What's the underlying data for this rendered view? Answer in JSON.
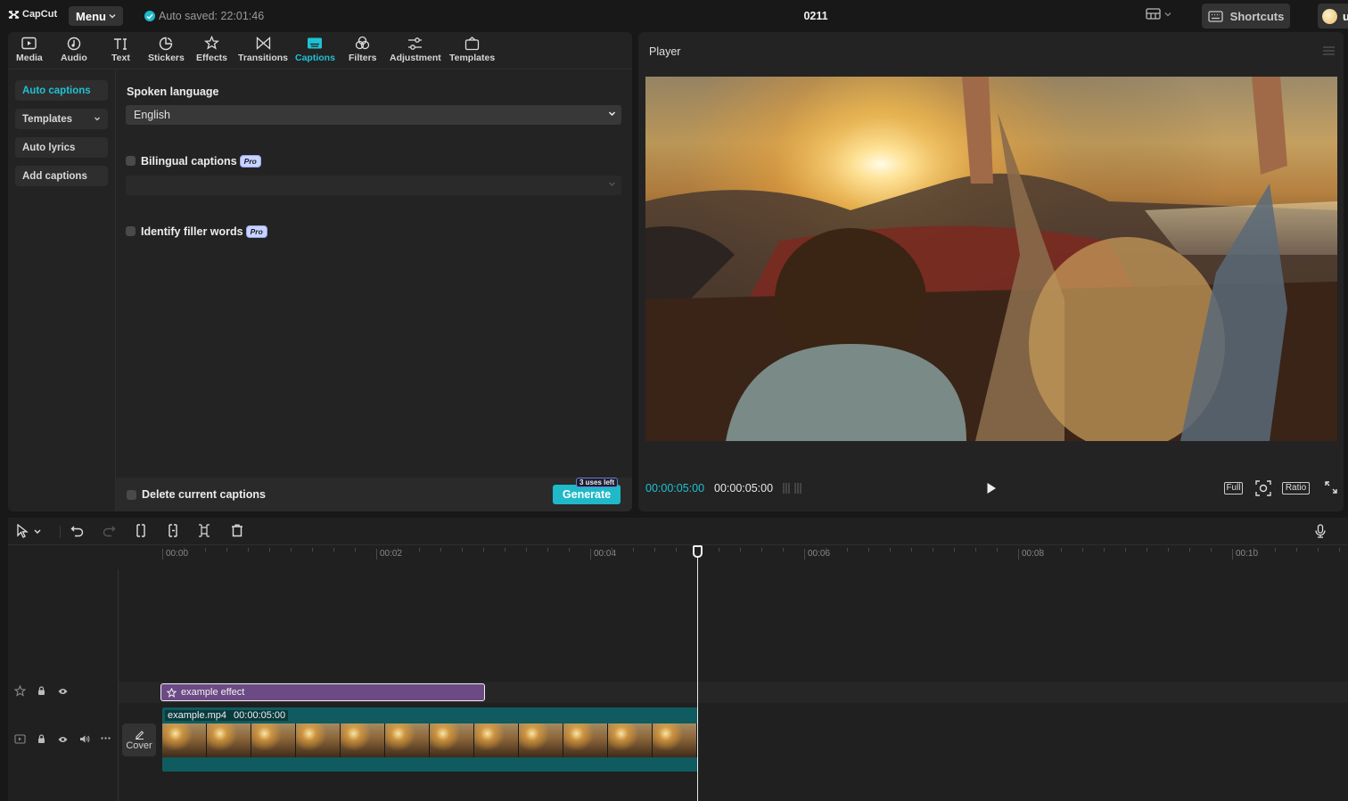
{
  "app": {
    "name": "CapCut",
    "menu_label": "Menu",
    "autosave_text": "Auto saved: 22:01:46",
    "project_title": "0211",
    "shortcuts_label": "Shortcuts",
    "user_initial": "u"
  },
  "toolbar": {
    "items": [
      {
        "label": "Media",
        "icon": "media-icon"
      },
      {
        "label": "Audio",
        "icon": "audio-icon"
      },
      {
        "label": "Text",
        "icon": "text-icon"
      },
      {
        "label": "Stickers",
        "icon": "stickers-icon"
      },
      {
        "label": "Effects",
        "icon": "effects-icon"
      },
      {
        "label": "Transitions",
        "icon": "transitions-icon"
      },
      {
        "label": "Captions",
        "icon": "captions-icon",
        "active": true
      },
      {
        "label": "Filters",
        "icon": "filters-icon"
      },
      {
        "label": "Adjustment",
        "icon": "adjustment-icon"
      },
      {
        "label": "Templates",
        "icon": "templates-icon"
      }
    ]
  },
  "sidenav": {
    "items": [
      {
        "label": "Auto captions",
        "active": true
      },
      {
        "label": "Templates",
        "has_dropdown": true
      },
      {
        "label": "Auto lyrics"
      },
      {
        "label": "Add captions"
      }
    ]
  },
  "captions": {
    "spoken_language_label": "Spoken language",
    "spoken_language_value": "English",
    "bilingual_label": "Bilingual captions",
    "bilingual_checked": false,
    "bilingual_value": "",
    "filler_label": "Identify filler words",
    "filler_checked": false,
    "pro_badge": "Pro",
    "delete_label": "Delete current captions",
    "delete_checked": false,
    "generate_label": "Generate",
    "uses_left": "3 uses left"
  },
  "player": {
    "title": "Player",
    "current_time": "00:00:05:00",
    "total_time": "00:00:05:00",
    "full_label": "Full",
    "ratio_label": "Ratio"
  },
  "timeline": {
    "ruler_labels": [
      "00:00",
      "00:02",
      "00:04",
      "00:06",
      "00:08",
      "00:10"
    ],
    "effect_clip_label": "example effect",
    "video_clip_name": "example.mp4",
    "video_clip_duration": "00:00:05:00",
    "cover_label": "Cover"
  },
  "colors": {
    "accent": "#1fc1d2",
    "effect_clip": "#6c4a86",
    "video_clip": "#0f5b5f",
    "background": "#181818",
    "panel": "#232323"
  }
}
